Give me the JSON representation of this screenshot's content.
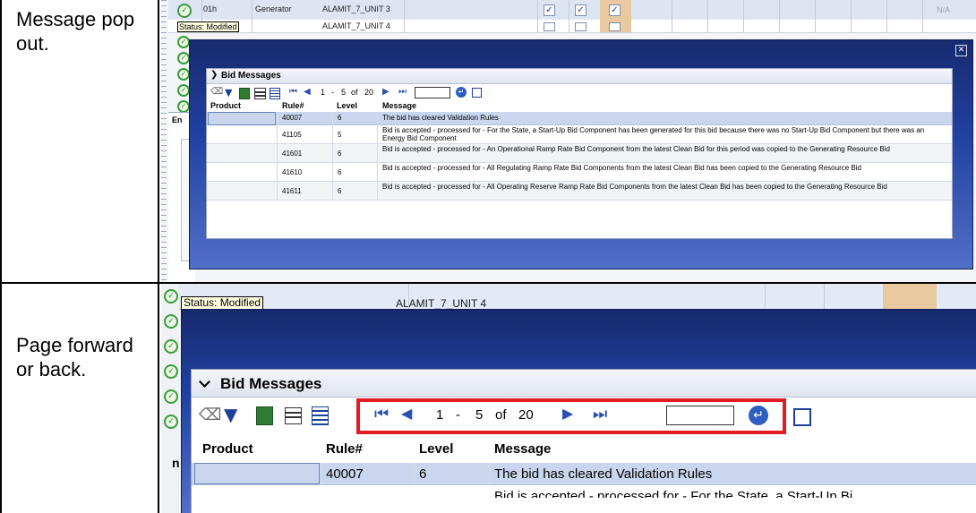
{
  "rows": [
    {
      "caption": "Message pop out."
    },
    {
      "caption": "Page forward or back."
    }
  ],
  "background_grid": {
    "hour": "01h",
    "type": "Generator",
    "resource": "ALAMIT_7_UNIT 3",
    "status_tooltip": "Status: Modified",
    "na_label": "N/A",
    "resource_partial": "ALAMIT_7_UNIT 4",
    "tab_partial": "En"
  },
  "popup": {
    "close_label": "✕",
    "panel_title": "Bid Messages",
    "pager": {
      "from": "1",
      "sep": "-",
      "to": "5",
      "of_label": "of",
      "total": "20"
    },
    "go_field_value": "",
    "columns": [
      "Product",
      "Rule#",
      "Level",
      "Message"
    ],
    "messages": [
      {
        "product": "",
        "rule": "40007",
        "level": "6",
        "message": "The bid has cleared Validation Rules"
      },
      {
        "product": "",
        "rule": "41105",
        "level": "5",
        "message": "Bid is accepted  -  processed for - For the State, a Start-Up Bid Component has been generated for this bid because there was no Start-Up Bid Component but there was an Energy Bid Component"
      },
      {
        "product": "",
        "rule": "41601",
        "level": "6",
        "message": "Bid is accepted  -  processed for - An Operational Ramp Rate Bid Component from the latest Clean Bid for this period was copied to the Generating Resource Bid"
      },
      {
        "product": "",
        "rule": "41610",
        "level": "6",
        "message": "Bid is accepted  -  processed for - All Regulating Ramp Rate Bid Components from the latest Clean Bid has been copied to the Generating Resource Bid"
      },
      {
        "product": "",
        "rule": "41611",
        "level": "6",
        "message": "Bid is accepted  -  processed for - All Operating Reserve Ramp Rate Bid Components from the latest Clean Bid has been copied to the Generating Resource Bid"
      }
    ]
  },
  "zoomed": {
    "status_tooltip": "Status: Modified",
    "resource_partial": "ALAMIT_7_UNIT 4",
    "partial_letter": "n",
    "message_partial": "Bid is accepted  -  processed for - For the State, a Start-Up Bi"
  },
  "colors": {
    "highlight": "#e31b23",
    "popup_header": "#1c2f78",
    "selected_row": "#c9d6ee",
    "panel_title_bg": "#e6eaf2",
    "grid_selected_column": "#e8c9a0"
  },
  "icons": [
    "eraser-icon",
    "filter-icon",
    "export-excel-icon",
    "print-icon",
    "details-icon",
    "first-page-icon",
    "prev-page-icon",
    "next-page-icon",
    "last-page-icon",
    "go-icon",
    "popout-icon",
    "close-icon",
    "valid-check-icon"
  ]
}
